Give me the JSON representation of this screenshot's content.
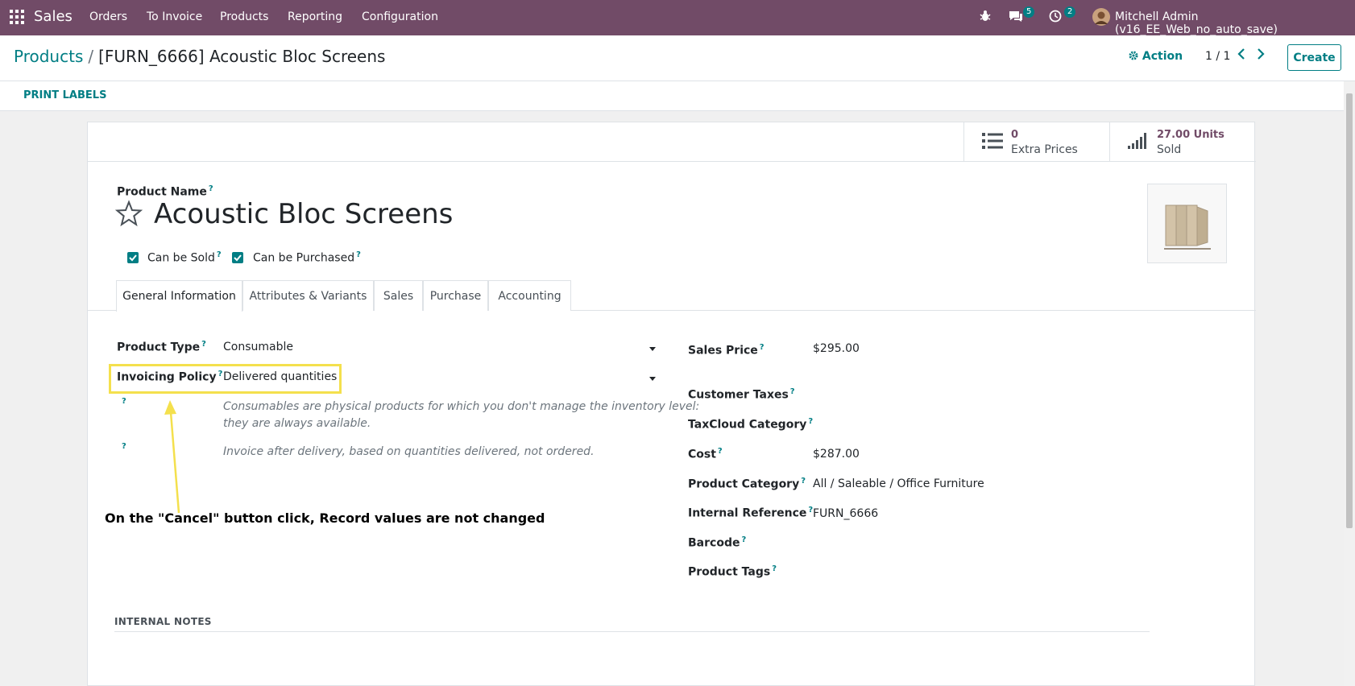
{
  "navbar": {
    "app_name": "Sales",
    "menu": [
      "Orders",
      "To Invoice",
      "Products",
      "Reporting",
      "Configuration"
    ],
    "messages_count": "5",
    "activities_count": "2",
    "user": "Mitchell Admin (v16_EE_Web_no_auto_save)",
    "brand_color": "#714B67"
  },
  "breadcrumb": {
    "parent": "Products",
    "sep": "/",
    "current": "[FURN_6666] Acoustic Bloc Screens"
  },
  "control": {
    "action": "Action",
    "pager": "1 / 1",
    "create": "Create"
  },
  "statusbar": {
    "print_labels": "PRINT LABELS"
  },
  "stats": {
    "extra_prices": {
      "value": "0",
      "label": "Extra Prices"
    },
    "sold": {
      "value": "27.00 Units",
      "label": "Sold"
    }
  },
  "product": {
    "name_label": "Product Name",
    "name": "Acoustic Bloc Screens",
    "can_be_sold": "Can be Sold",
    "can_be_purchased": "Can be Purchased"
  },
  "tabs": [
    "General Information",
    "Attributes & Variants",
    "Sales",
    "Purchase",
    "Accounting"
  ],
  "left_fields": {
    "product_type_label": "Product Type",
    "product_type": "Consumable",
    "invoicing_policy_label": "Invoicing Policy",
    "invoicing_policy": "Delivered quantities",
    "help_1a": "Consumables are physical products for which you don't manage the inventory level:",
    "help_1b": "they are always available.",
    "help_2": "Invoice after delivery, based on quantities delivered, not ordered."
  },
  "right_fields": {
    "sales_price_label": "Sales Price",
    "sales_price": "$295.00",
    "customer_taxes_label": "Customer Taxes",
    "taxcloud_label": "TaxCloud Category",
    "cost_label": "Cost",
    "cost": "$287.00",
    "category_label": "Product Category",
    "category": "All / Saleable / Office Furniture",
    "internal_ref_label": "Internal Reference",
    "internal_ref": "FURN_6666",
    "barcode_label": "Barcode",
    "tags_label": "Product Tags"
  },
  "annotation": "On the \"Cancel\" button click, Record values are not changed",
  "internal_notes": "INTERNAL NOTES",
  "accent_color": "#017e84",
  "highlight_color": "#f4e04d"
}
